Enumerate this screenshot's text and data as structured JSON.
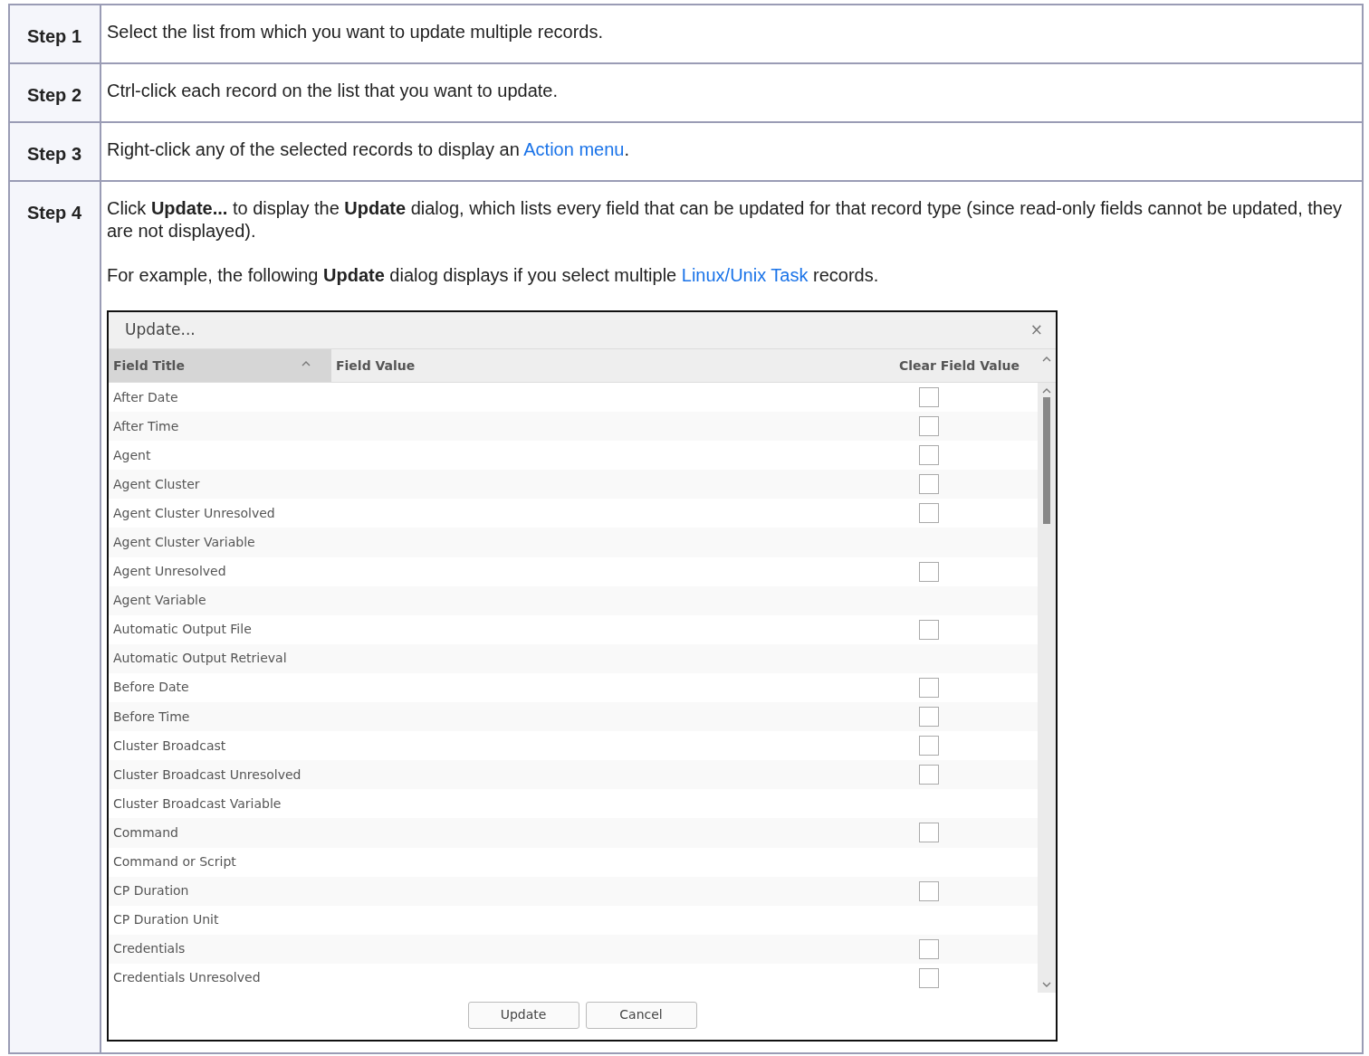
{
  "steps": [
    {
      "label": "Step 1",
      "paragraphs": [
        {
          "before": "Select the list from which you want to update multiple records."
        }
      ]
    },
    {
      "label": "Step 2",
      "paragraphs": [
        {
          "before": "Ctrl-click each record on the list that you want to update."
        }
      ]
    },
    {
      "label": "Step 3",
      "paragraphs": [
        {
          "before": "Right-click any of the selected records to display an ",
          "link": "Action menu",
          "after": "."
        }
      ]
    },
    {
      "label": "Step 4",
      "paragraphs": [
        {
          "before": "Click **Update...** to display the **Update** dialog, which lists every field that can be updated for that record type (since read-only fields cannot be updated, they are not displayed)."
        },
        {
          "before": "For example, the following **Update** dialog displays if you select multiple ",
          "link": "Linux/Unix Task",
          "after": " records."
        }
      ],
      "dialog": {
        "title": "Update...",
        "close": "×",
        "columns": [
          {
            "label": "Field Title",
            "sorted": true
          },
          {
            "label": "Field Value",
            "sorted": false
          },
          {
            "label": "Clear Field Value",
            "sorted": false
          }
        ],
        "rows": [
          {
            "title": "After Date",
            "kind": "checkbox",
            "checked": false
          },
          {
            "title": "After Time",
            "kind": "checkbox",
            "checked": false
          },
          {
            "title": "Agent",
            "kind": "checkbox",
            "checked": false
          },
          {
            "title": "Agent Cluster",
            "kind": "checkbox",
            "checked": false
          },
          {
            "title": "Agent Cluster Unresolved",
            "kind": "checkbox",
            "checked": false
          },
          {
            "title": "Agent Cluster Variable",
            "kind": "plain"
          },
          {
            "title": "Agent Unresolved",
            "kind": "checkbox",
            "checked": false
          },
          {
            "title": "Agent Variable",
            "kind": "plain"
          },
          {
            "title": "Automatic Output File",
            "kind": "checkbox",
            "checked": false
          },
          {
            "title": "Automatic Output Retrieval",
            "kind": "plain"
          },
          {
            "title": "Before Date",
            "kind": "checkbox",
            "checked": false
          },
          {
            "title": "Before Time",
            "kind": "checkbox",
            "checked": false
          },
          {
            "title": "Cluster Broadcast",
            "kind": "checkbox",
            "checked": false
          },
          {
            "title": "Cluster Broadcast Unresolved",
            "kind": "checkbox",
            "checked": false
          },
          {
            "title": "Cluster Broadcast Variable",
            "kind": "plain"
          },
          {
            "title": "Command",
            "kind": "checkbox",
            "checked": false
          },
          {
            "title": "Command or Script",
            "kind": "plain"
          },
          {
            "title": "CP Duration",
            "kind": "checkbox",
            "checked": false
          },
          {
            "title": "CP Duration Unit",
            "kind": "plain"
          },
          {
            "title": "Credentials",
            "kind": "checkbox",
            "checked": false
          },
          {
            "title": "Credentials Unresolved",
            "kind": "checkbox",
            "checked": false
          }
        ],
        "buttons": [
          "Update",
          "Cancel"
        ]
      }
    }
  ]
}
